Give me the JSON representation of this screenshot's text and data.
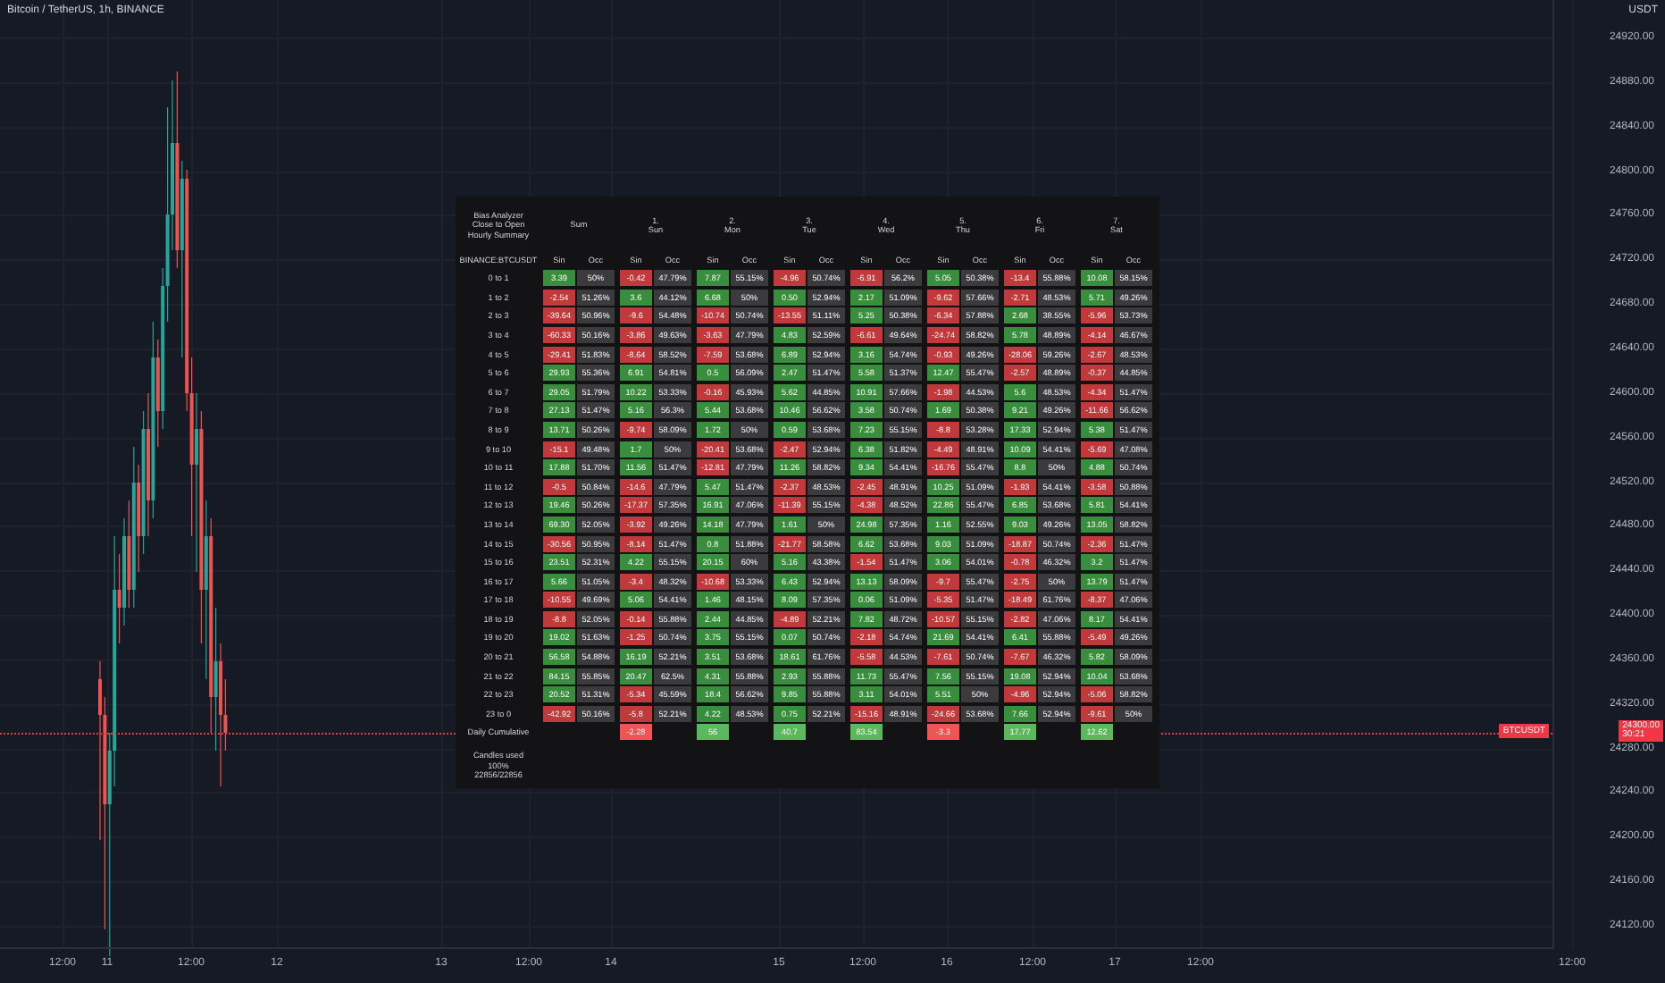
{
  "chart": {
    "title": "Bitcoin / TetherUS, 1h, BINANCE",
    "currency": "USDT",
    "price_ticks": [
      "24920.00",
      "24880.00",
      "24840.00",
      "24800.00",
      "24760.00",
      "24720.00",
      "24680.00",
      "24640.00",
      "24600.00",
      "24560.00",
      "24520.00",
      "24480.00",
      "24440.00",
      "24400.00",
      "24360.00",
      "24320.00",
      "24280.00",
      "24240.00",
      "24200.00",
      "24160.00",
      "24120.00"
    ],
    "time_ticks": [
      "12:00",
      "11",
      "12:00",
      "12",
      "13",
      "12:00",
      "14",
      "15",
      "12:00",
      "16",
      "12:00",
      "17",
      "12:00",
      "12:00"
    ],
    "symbol_tag": "BTCUSDT",
    "last_price": "24300.00",
    "countdown": "30:21"
  },
  "table": {
    "title_lines": [
      "Bias Analyzer",
      "Close to Open",
      "Hourly Summary"
    ],
    "symbol": "BINANCE:BTCUSDT",
    "groups": [
      {
        "name": "Sum",
        "columns": [
          "Sin",
          "Occ"
        ]
      },
      {
        "number": "1.",
        "name": "Sun",
        "columns": [
          "Sin",
          "Occ"
        ]
      },
      {
        "number": "2.",
        "name": "Mon",
        "columns": [
          "Sin",
          "Occ"
        ]
      },
      {
        "number": "3.",
        "name": "Tue",
        "columns": [
          "Sin",
          "Occ"
        ]
      },
      {
        "number": "4.",
        "name": "Wed",
        "columns": [
          "Sin",
          "Occ"
        ]
      },
      {
        "number": "5.",
        "name": "Thu",
        "columns": [
          "Sin",
          "Occ"
        ]
      },
      {
        "number": "6.",
        "name": "Fri",
        "columns": [
          "Sin",
          "Occ"
        ]
      },
      {
        "number": "7.",
        "name": "Sat",
        "columns": [
          "Sin",
          "Occ"
        ]
      }
    ],
    "rows": [
      {
        "label": "0 to 1",
        "cells": [
          {
            "sin": "3.39",
            "occ": "50%",
            "color": "#388e3c"
          },
          {
            "sin": "-0.42",
            "occ": "47.79%",
            "color": "#c2393c"
          },
          {
            "sin": "7.87",
            "occ": "55.15%",
            "color": "#388e3c"
          },
          {
            "sin": "-4.96",
            "occ": "50.74%",
            "color": "#c2393c"
          },
          {
            "sin": "-6.91",
            "occ": "56.2%",
            "color": "#c2393c"
          },
          {
            "sin": "5.05",
            "occ": "50.38%",
            "color": "#388e3c"
          },
          {
            "sin": "-13.4",
            "occ": "55.88%",
            "color": "#c2393c"
          },
          {
            "sin": "10.08",
            "occ": "58.15%",
            "color": "#388e3c"
          }
        ]
      },
      {
        "label": "1 to 2",
        "cells": [
          {
            "sin": "-2.54",
            "occ": "51.26%",
            "color": "#c2393c"
          },
          {
            "sin": "3.6",
            "occ": "44.12%",
            "color": "#388e3c"
          },
          {
            "sin": "6.68",
            "occ": "50%",
            "color": "#388e3c"
          },
          {
            "sin": "0.50",
            "occ": "52.94%",
            "color": "#388e3c"
          },
          {
            "sin": "2.17",
            "occ": "51.09%",
            "color": "#388e3c"
          },
          {
            "sin": "-9.62",
            "occ": "57.66%",
            "color": "#c2393c"
          },
          {
            "sin": "-2.71",
            "occ": "48.53%",
            "color": "#c2393c"
          },
          {
            "sin": "5.71",
            "occ": "49.26%",
            "color": "#388e3c"
          }
        ]
      },
      {
        "label": "2 to 3",
        "cells": [
          {
            "sin": "-39.64",
            "occ": "50.96%",
            "color": "#c2393c"
          },
          {
            "sin": "-9.6",
            "occ": "54.48%",
            "color": "#c2393c"
          },
          {
            "sin": "-10.74",
            "occ": "50.74%",
            "color": "#c2393c"
          },
          {
            "sin": "-13.55",
            "occ": "51.11%",
            "color": "#c2393c"
          },
          {
            "sin": "5.25",
            "occ": "50.38%",
            "color": "#388e3c"
          },
          {
            "sin": "-6.34",
            "occ": "57.88%",
            "color": "#c2393c"
          },
          {
            "sin": "2.68",
            "occ": "38.55%",
            "color": "#388e3c"
          },
          {
            "sin": "-5.96",
            "occ": "53.73%",
            "color": "#c2393c"
          }
        ]
      },
      {
        "label": "3 to 4",
        "cells": [
          {
            "sin": "-60.33",
            "occ": "50.16%",
            "color": "#c2393c"
          },
          {
            "sin": "-3.86",
            "occ": "49.63%",
            "color": "#c2393c"
          },
          {
            "sin": "-3.63",
            "occ": "47.79%",
            "color": "#c2393c"
          },
          {
            "sin": "4.83",
            "occ": "52.59%",
            "color": "#388e3c"
          },
          {
            "sin": "-6.61",
            "occ": "49.64%",
            "color": "#c2393c"
          },
          {
            "sin": "-24.74",
            "occ": "58.82%",
            "color": "#c2393c"
          },
          {
            "sin": "5.78",
            "occ": "48.89%",
            "color": "#388e3c"
          },
          {
            "sin": "-4.14",
            "occ": "46.67%",
            "color": "#c2393c"
          }
        ]
      },
      {
        "label": "4 to 5",
        "cells": [
          {
            "sin": "-29.41",
            "occ": "51.83%",
            "color": "#c2393c"
          },
          {
            "sin": "-8.64",
            "occ": "58.52%",
            "color": "#c2393c"
          },
          {
            "sin": "-7.59",
            "occ": "53.68%",
            "color": "#c2393c"
          },
          {
            "sin": "6.89",
            "occ": "52.94%",
            "color": "#388e3c"
          },
          {
            "sin": "3.16",
            "occ": "54.74%",
            "color": "#388e3c"
          },
          {
            "sin": "-0.93",
            "occ": "49.26%",
            "color": "#c2393c"
          },
          {
            "sin": "-28.06",
            "occ": "59.26%",
            "color": "#c2393c"
          },
          {
            "sin": "-2.67",
            "occ": "48.53%",
            "color": "#c2393c"
          }
        ]
      },
      {
        "label": "5 to 6",
        "cells": [
          {
            "sin": "29.93",
            "occ": "55.36%",
            "color": "#388e3c"
          },
          {
            "sin": "6.91",
            "occ": "54.81%",
            "color": "#388e3c"
          },
          {
            "sin": "0.5",
            "occ": "56.09%",
            "color": "#388e3c"
          },
          {
            "sin": "2.47",
            "occ": "51.47%",
            "color": "#388e3c"
          },
          {
            "sin": "5.58",
            "occ": "51.37%",
            "color": "#388e3c"
          },
          {
            "sin": "12.47",
            "occ": "55.47%",
            "color": "#388e3c"
          },
          {
            "sin": "-2.57",
            "occ": "48.89%",
            "color": "#c2393c"
          },
          {
            "sin": "-0.37",
            "occ": "44.85%",
            "color": "#c2393c"
          }
        ]
      },
      {
        "label": "6 to 7",
        "cells": [
          {
            "sin": "29.05",
            "occ": "51.79%",
            "color": "#388e3c"
          },
          {
            "sin": "10.22",
            "occ": "53.33%",
            "color": "#388e3c"
          },
          {
            "sin": "-0.16",
            "occ": "45.93%",
            "color": "#c2393c"
          },
          {
            "sin": "5.62",
            "occ": "44.85%",
            "color": "#388e3c"
          },
          {
            "sin": "10.91",
            "occ": "57.66%",
            "color": "#388e3c"
          },
          {
            "sin": "-1.98",
            "occ": "44.53%",
            "color": "#c2393c"
          },
          {
            "sin": "5.6",
            "occ": "48.53%",
            "color": "#388e3c"
          },
          {
            "sin": "-4.34",
            "occ": "51.47%",
            "color": "#c2393c"
          }
        ]
      },
      {
        "label": "7 to 8",
        "cells": [
          {
            "sin": "27.13",
            "occ": "51.47%",
            "color": "#388e3c"
          },
          {
            "sin": "5.16",
            "occ": "56.3%",
            "color": "#388e3c"
          },
          {
            "sin": "5.44",
            "occ": "53.68%",
            "color": "#388e3c"
          },
          {
            "sin": "10.46",
            "occ": "56.62%",
            "color": "#388e3c"
          },
          {
            "sin": "3.58",
            "occ": "50.74%",
            "color": "#388e3c"
          },
          {
            "sin": "1.69",
            "occ": "50.38%",
            "color": "#388e3c"
          },
          {
            "sin": "9.21",
            "occ": "49.26%",
            "color": "#388e3c"
          },
          {
            "sin": "-11.66",
            "occ": "56.62%",
            "color": "#c2393c"
          }
        ]
      },
      {
        "label": "8 to 9",
        "cells": [
          {
            "sin": "13.71",
            "occ": "50.26%",
            "color": "#388e3c"
          },
          {
            "sin": "-9.74",
            "occ": "58.09%",
            "color": "#c2393c"
          },
          {
            "sin": "1.72",
            "occ": "50%",
            "color": "#388e3c"
          },
          {
            "sin": "0.59",
            "occ": "53.68%",
            "color": "#388e3c"
          },
          {
            "sin": "7.23",
            "occ": "55.15%",
            "color": "#388e3c"
          },
          {
            "sin": "-8.8",
            "occ": "53.28%",
            "color": "#c2393c"
          },
          {
            "sin": "17.33",
            "occ": "52.94%",
            "color": "#388e3c"
          },
          {
            "sin": "5.38",
            "occ": "51.47%",
            "color": "#388e3c"
          }
        ]
      },
      {
        "label": "9 to 10",
        "cells": [
          {
            "sin": "-15.1",
            "occ": "49.48%",
            "color": "#c2393c"
          },
          {
            "sin": "1.7",
            "occ": "50%",
            "color": "#388e3c"
          },
          {
            "sin": "-20.41",
            "occ": "53.68%",
            "color": "#c2393c"
          },
          {
            "sin": "-2.47",
            "occ": "52.94%",
            "color": "#c2393c"
          },
          {
            "sin": "6.38",
            "occ": "51.82%",
            "color": "#388e3c"
          },
          {
            "sin": "-4.49",
            "occ": "48.91%",
            "color": "#c2393c"
          },
          {
            "sin": "10.09",
            "occ": "54.41%",
            "color": "#388e3c"
          },
          {
            "sin": "-5.69",
            "occ": "47.08%",
            "color": "#c2393c"
          }
        ]
      },
      {
        "label": "10 to 11",
        "cells": [
          {
            "sin": "17.88",
            "occ": "51.70%",
            "color": "#388e3c"
          },
          {
            "sin": "11.56",
            "occ": "51.47%",
            "color": "#388e3c"
          },
          {
            "sin": "-12.81",
            "occ": "47.79%",
            "color": "#c2393c"
          },
          {
            "sin": "11.26",
            "occ": "58.82%",
            "color": "#388e3c"
          },
          {
            "sin": "9.34",
            "occ": "54.41%",
            "color": "#388e3c"
          },
          {
            "sin": "-16.76",
            "occ": "55.47%",
            "color": "#c2393c"
          },
          {
            "sin": "8.8",
            "occ": "50%",
            "color": "#388e3c"
          },
          {
            "sin": "4.88",
            "occ": "50.74%",
            "color": "#388e3c"
          }
        ]
      },
      {
        "label": "11 to 12",
        "cells": [
          {
            "sin": "-0.5",
            "occ": "50.84%",
            "color": "#c2393c"
          },
          {
            "sin": "-14.6",
            "occ": "47.79%",
            "color": "#c2393c"
          },
          {
            "sin": "5.47",
            "occ": "51.47%",
            "color": "#388e3c"
          },
          {
            "sin": "-2.37",
            "occ": "48.53%",
            "color": "#c2393c"
          },
          {
            "sin": "-2.45",
            "occ": "48.91%",
            "color": "#c2393c"
          },
          {
            "sin": "10.25",
            "occ": "51.09%",
            "color": "#388e3c"
          },
          {
            "sin": "-1.93",
            "occ": "54.41%",
            "color": "#c2393c"
          },
          {
            "sin": "-3.58",
            "occ": "50.88%",
            "color": "#c2393c"
          }
        ]
      },
      {
        "label": "12 to 13",
        "cells": [
          {
            "sin": "19.46",
            "occ": "50.26%",
            "color": "#388e3c"
          },
          {
            "sin": "-17.37",
            "occ": "57.35%",
            "color": "#c2393c"
          },
          {
            "sin": "16.91",
            "occ": "47.06%",
            "color": "#388e3c"
          },
          {
            "sin": "-11.39",
            "occ": "55.15%",
            "color": "#c2393c"
          },
          {
            "sin": "-4.38",
            "occ": "48.52%",
            "color": "#c2393c"
          },
          {
            "sin": "22.86",
            "occ": "55.47%",
            "color": "#388e3c"
          },
          {
            "sin": "6.85",
            "occ": "53.68%",
            "color": "#388e3c"
          },
          {
            "sin": "5.81",
            "occ": "54.41%",
            "color": "#388e3c"
          }
        ]
      },
      {
        "label": "13 to 14",
        "cells": [
          {
            "sin": "69.30",
            "occ": "52.05%",
            "color": "#388e3c"
          },
          {
            "sin": "-3.92",
            "occ": "49.26%",
            "color": "#c2393c"
          },
          {
            "sin": "14.18",
            "occ": "47.79%",
            "color": "#388e3c"
          },
          {
            "sin": "1.61",
            "occ": "50%",
            "color": "#388e3c"
          },
          {
            "sin": "24.98",
            "occ": "57.35%",
            "color": "#388e3c"
          },
          {
            "sin": "1.16",
            "occ": "52.55%",
            "color": "#388e3c"
          },
          {
            "sin": "9.03",
            "occ": "49.26%",
            "color": "#388e3c"
          },
          {
            "sin": "13.05",
            "occ": "58.82%",
            "color": "#388e3c"
          }
        ]
      },
      {
        "label": "14 to 15",
        "cells": [
          {
            "sin": "-30.56",
            "occ": "50.95%",
            "color": "#c2393c"
          },
          {
            "sin": "-8.14",
            "occ": "51.47%",
            "color": "#c2393c"
          },
          {
            "sin": "0.8",
            "occ": "51.88%",
            "color": "#388e3c"
          },
          {
            "sin": "-21.77",
            "occ": "58.58%",
            "color": "#c2393c"
          },
          {
            "sin": "6.62",
            "occ": "53.68%",
            "color": "#388e3c"
          },
          {
            "sin": "9.03",
            "occ": "51.09%",
            "color": "#388e3c"
          },
          {
            "sin": "-18.87",
            "occ": "50.74%",
            "color": "#c2393c"
          },
          {
            "sin": "-2.36",
            "occ": "51.47%",
            "color": "#c2393c"
          }
        ]
      },
      {
        "label": "15 to 16",
        "cells": [
          {
            "sin": "23.51",
            "occ": "52.31%",
            "color": "#388e3c"
          },
          {
            "sin": "4.22",
            "occ": "55.15%",
            "color": "#388e3c"
          },
          {
            "sin": "20.15",
            "occ": "60%",
            "color": "#388e3c"
          },
          {
            "sin": "5.16",
            "occ": "43.38%",
            "color": "#388e3c"
          },
          {
            "sin": "-1.54",
            "occ": "51.47%",
            "color": "#c2393c"
          },
          {
            "sin": "3.06",
            "occ": "54.01%",
            "color": "#388e3c"
          },
          {
            "sin": "-0.78",
            "occ": "46.32%",
            "color": "#c2393c"
          },
          {
            "sin": "3.2",
            "occ": "51.47%",
            "color": "#388e3c"
          }
        ]
      },
      {
        "label": "16 to 17",
        "cells": [
          {
            "sin": "5.66",
            "occ": "51.05%",
            "color": "#388e3c"
          },
          {
            "sin": "-3.4",
            "occ": "48.32%",
            "color": "#c2393c"
          },
          {
            "sin": "-10.68",
            "occ": "53.33%",
            "color": "#c2393c"
          },
          {
            "sin": "6.43",
            "occ": "52.94%",
            "color": "#388e3c"
          },
          {
            "sin": "13.13",
            "occ": "58.09%",
            "color": "#388e3c"
          },
          {
            "sin": "-9.7",
            "occ": "55.47%",
            "color": "#c2393c"
          },
          {
            "sin": "-2.75",
            "occ": "50%",
            "color": "#c2393c"
          },
          {
            "sin": "13.79",
            "occ": "51.47%",
            "color": "#388e3c"
          }
        ]
      },
      {
        "label": "17 to 18",
        "cells": [
          {
            "sin": "-10.55",
            "occ": "49.69%",
            "color": "#c2393c"
          },
          {
            "sin": "5.06",
            "occ": "54.41%",
            "color": "#388e3c"
          },
          {
            "sin": "1.46",
            "occ": "48.15%",
            "color": "#388e3c"
          },
          {
            "sin": "8.09",
            "occ": "57.35%",
            "color": "#388e3c"
          },
          {
            "sin": "0.06",
            "occ": "51.09%",
            "color": "#388e3c"
          },
          {
            "sin": "-5.35",
            "occ": "51.47%",
            "color": "#c2393c"
          },
          {
            "sin": "-18.49",
            "occ": "61.76%",
            "color": "#c2393c"
          },
          {
            "sin": "-8.37",
            "occ": "47.06%",
            "color": "#c2393c"
          }
        ]
      },
      {
        "label": "18 to 19",
        "cells": [
          {
            "sin": "-8.8",
            "occ": "52.05%",
            "color": "#c2393c"
          },
          {
            "sin": "-0.14",
            "occ": "55.88%",
            "color": "#c2393c"
          },
          {
            "sin": "2.44",
            "occ": "44.85%",
            "color": "#388e3c"
          },
          {
            "sin": "-4.89",
            "occ": "52.21%",
            "color": "#c2393c"
          },
          {
            "sin": "7.82",
            "occ": "48.72%",
            "color": "#388e3c"
          },
          {
            "sin": "-10.57",
            "occ": "55.15%",
            "color": "#c2393c"
          },
          {
            "sin": "-2.82",
            "occ": "47.06%",
            "color": "#c2393c"
          },
          {
            "sin": "8.17",
            "occ": "54.41%",
            "color": "#388e3c"
          }
        ]
      },
      {
        "label": "19 to 20",
        "cells": [
          {
            "sin": "19.02",
            "occ": "51.63%",
            "color": "#388e3c"
          },
          {
            "sin": "-1.25",
            "occ": "50.74%",
            "color": "#c2393c"
          },
          {
            "sin": "3.75",
            "occ": "55.15%",
            "color": "#388e3c"
          },
          {
            "sin": "0.07",
            "occ": "50.74%",
            "color": "#388e3c"
          },
          {
            "sin": "-2.18",
            "occ": "54.74%",
            "color": "#c2393c"
          },
          {
            "sin": "21.69",
            "occ": "54.41%",
            "color": "#388e3c"
          },
          {
            "sin": "6.41",
            "occ": "55.88%",
            "color": "#388e3c"
          },
          {
            "sin": "-5.49",
            "occ": "49.26%",
            "color": "#c2393c"
          }
        ]
      },
      {
        "label": "20 to 21",
        "cells": [
          {
            "sin": "56.58",
            "occ": "54.88%",
            "color": "#388e3c"
          },
          {
            "sin": "16.19",
            "occ": "52.21%",
            "color": "#388e3c"
          },
          {
            "sin": "3.51",
            "occ": "53.68%",
            "color": "#388e3c"
          },
          {
            "sin": "18.61",
            "occ": "61.76%",
            "color": "#388e3c"
          },
          {
            "sin": "-5.58",
            "occ": "44.53%",
            "color": "#c2393c"
          },
          {
            "sin": "-7.61",
            "occ": "50.74%",
            "color": "#c2393c"
          },
          {
            "sin": "-7.67",
            "occ": "46.32%",
            "color": "#c2393c"
          },
          {
            "sin": "5.82",
            "occ": "58.09%",
            "color": "#388e3c"
          }
        ]
      },
      {
        "label": "21 to 22",
        "cells": [
          {
            "sin": "84.15",
            "occ": "55.85%",
            "color": "#388e3c"
          },
          {
            "sin": "20.47",
            "occ": "62.5%",
            "color": "#388e3c"
          },
          {
            "sin": "4.31",
            "occ": "55.88%",
            "color": "#388e3c"
          },
          {
            "sin": "2.93",
            "occ": "55.88%",
            "color": "#388e3c"
          },
          {
            "sin": "11.73",
            "occ": "55.47%",
            "color": "#388e3c"
          },
          {
            "sin": "7.56",
            "occ": "55.15%",
            "color": "#388e3c"
          },
          {
            "sin": "19.08",
            "occ": "52.94%",
            "color": "#388e3c"
          },
          {
            "sin": "10.04",
            "occ": "53.68%",
            "color": "#388e3c"
          }
        ]
      },
      {
        "label": "22 to 23",
        "cells": [
          {
            "sin": "20.52",
            "occ": "51.31%",
            "color": "#388e3c"
          },
          {
            "sin": "-5.34",
            "occ": "45.59%",
            "color": "#c2393c"
          },
          {
            "sin": "18.4",
            "occ": "56.62%",
            "color": "#388e3c"
          },
          {
            "sin": "9.85",
            "occ": "55.88%",
            "color": "#388e3c"
          },
          {
            "sin": "3.11",
            "occ": "54.01%",
            "color": "#388e3c"
          },
          {
            "sin": "5.51",
            "occ": "50%",
            "color": "#388e3c"
          },
          {
            "sin": "-4.96",
            "occ": "52.94%",
            "color": "#c2393c"
          },
          {
            "sin": "-5.06",
            "occ": "58.82%",
            "color": "#c2393c"
          }
        ]
      },
      {
        "label": "23 to 0",
        "cells": [
          {
            "sin": "-42.92",
            "occ": "50.16%",
            "color": "#c2393c"
          },
          {
            "sin": "-5.8",
            "occ": "52.21%",
            "color": "#c2393c"
          },
          {
            "sin": "4.22",
            "occ": "48.53%",
            "color": "#388e3c"
          },
          {
            "sin": "0.75",
            "occ": "52.21%",
            "color": "#388e3c"
          },
          {
            "sin": "-15.16",
            "occ": "48.91%",
            "color": "#c2393c"
          },
          {
            "sin": "-24.66",
            "occ": "53.68%",
            "color": "#c2393c"
          },
          {
            "sin": "7.66",
            "occ": "52.94%",
            "color": "#388e3c"
          },
          {
            "sin": "-9.61",
            "occ": "50%",
            "color": "#c2393c"
          }
        ]
      }
    ],
    "cumulative": {
      "label": "Daily Cumulative",
      "cells": [
        {
          "value": "-2.28",
          "color": "#f05454"
        },
        {
          "value": "56",
          "color": "#5cb85c"
        },
        {
          "value": "40.7",
          "color": "#5cb85c"
        },
        {
          "value": "83.54",
          "color": "#5cb85c"
        },
        {
          "value": "-3.3",
          "color": "#f05454"
        },
        {
          "value": "17.77",
          "color": "#5cb85c"
        },
        {
          "value": "12.62",
          "color": "#5cb85c"
        }
      ]
    },
    "footer": [
      "Candles used",
      "100%",
      "22856/22856"
    ]
  }
}
